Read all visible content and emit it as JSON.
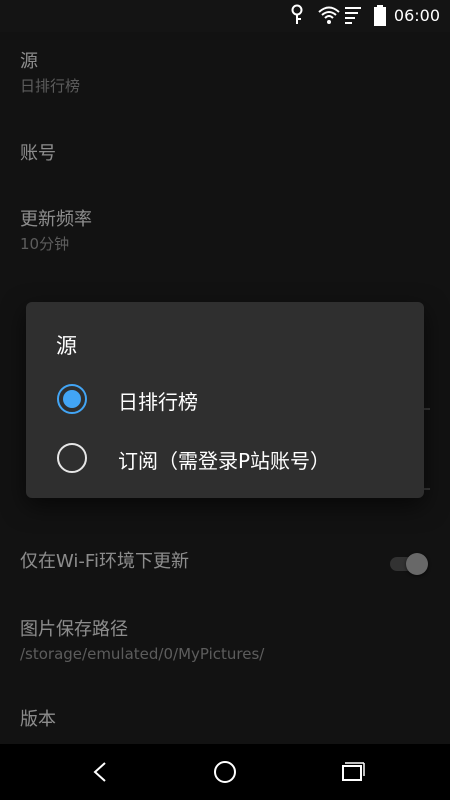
{
  "status_bar": {
    "time": "06:00",
    "icons": [
      "key-icon",
      "wifi-icon",
      "signal-icon",
      "battery-icon"
    ]
  },
  "settings": {
    "source": {
      "title": "源",
      "summary": "日排行榜"
    },
    "account": {
      "title": "账号"
    },
    "update_frequency": {
      "title": "更新频率",
      "summary": "10分钟"
    },
    "wifi_only": {
      "title": "仅在Wi-Fi环境下更新",
      "enabled": false
    },
    "save_path": {
      "title": "图片保存路径",
      "summary": "/storage/emulated/0/MyPictures/"
    },
    "version": {
      "title": "版本"
    }
  },
  "dialog": {
    "title": "源",
    "options": [
      {
        "label": "日排行榜",
        "selected": true
      },
      {
        "label": "订阅（需登录P站账号）",
        "selected": false
      }
    ]
  },
  "colors": {
    "accent": "#42a5f5",
    "background": "#212121",
    "dialog": "#2f2f2f"
  },
  "nav_bar": {
    "buttons": [
      "back-icon",
      "home-icon",
      "recents-icon"
    ]
  }
}
